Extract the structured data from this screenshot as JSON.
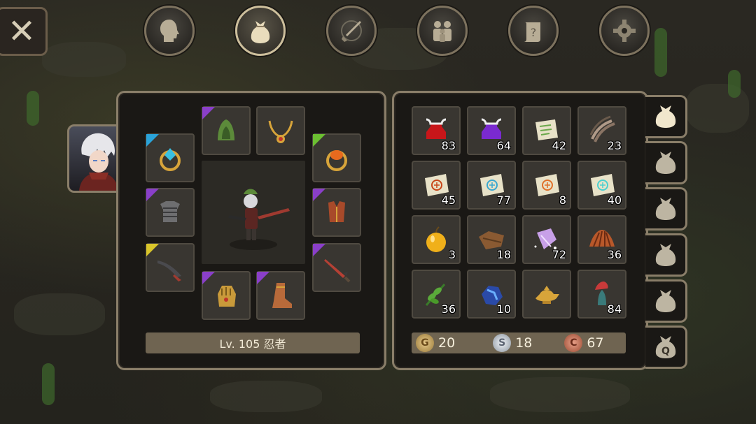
{
  "close": {
    "label": "✕"
  },
  "top_nav": [
    {
      "name": "nav-character",
      "icon": "head-icon",
      "active": false
    },
    {
      "name": "nav-inventory",
      "icon": "bag-icon",
      "active": true
    },
    {
      "name": "nav-skills",
      "icon": "sword-compass-icon",
      "active": false
    },
    {
      "name": "nav-party",
      "icon": "party-icon",
      "active": false
    },
    {
      "name": "nav-quests",
      "icon": "quest-scroll-icon",
      "active": false
    },
    {
      "name": "nav-settings",
      "icon": "gear-icon",
      "active": false
    }
  ],
  "character": {
    "level_text": "Lv. 105 忍者"
  },
  "equipment": [
    {
      "slot": "helmet",
      "icon": "green-hood-icon",
      "rarity": "#8a3fc9"
    },
    {
      "slot": "necklace",
      "icon": "gold-necklace-icon",
      "rarity": ""
    },
    {
      "slot": "ring-left",
      "icon": "blue-gem-ring-icon",
      "rarity": "#2aa3d9"
    },
    {
      "slot": "ring-right",
      "icon": "orange-gem-ring-icon",
      "rarity": "#6cbf32"
    },
    {
      "slot": "armor",
      "icon": "chainmail-icon",
      "rarity": "#8a3fc9"
    },
    {
      "slot": "cloak",
      "icon": "red-vest-icon",
      "rarity": "#8a3fc9"
    },
    {
      "slot": "weapon-left",
      "icon": "dark-blade-icon",
      "rarity": "#d9c52a"
    },
    {
      "slot": "weapon-right",
      "icon": "red-sword-icon",
      "rarity": "#8a3fc9"
    },
    {
      "slot": "gloves",
      "icon": "gold-gauntlet-icon",
      "rarity": "#8a3fc9"
    },
    {
      "slot": "boots",
      "icon": "leather-boot-icon",
      "rarity": "#8a3fc9"
    }
  ],
  "inventory": [
    {
      "icon": "red-potion-icon",
      "count": "83"
    },
    {
      "icon": "purple-potion-icon",
      "count": "64"
    },
    {
      "icon": "scroll-green-icon",
      "count": "42"
    },
    {
      "icon": "claw-icon",
      "count": "23"
    },
    {
      "icon": "scroll-red-rune-icon",
      "count": "45"
    },
    {
      "icon": "scroll-blue-rune-icon",
      "count": "77"
    },
    {
      "icon": "scroll-orange-rune-icon",
      "count": "8"
    },
    {
      "icon": "scroll-cyan-rune-icon",
      "count": "40"
    },
    {
      "icon": "golden-apple-icon",
      "count": "3"
    },
    {
      "icon": "leather-hide-icon",
      "count": "18"
    },
    {
      "icon": "crystal-shard-icon",
      "count": "72"
    },
    {
      "icon": "red-shell-icon",
      "count": "36"
    },
    {
      "icon": "green-herb-icon",
      "count": "36"
    },
    {
      "icon": "blue-ore-icon",
      "count": "10"
    },
    {
      "icon": "magic-lamp-icon",
      "count": ""
    },
    {
      "icon": "blue-mushroom-icon",
      "count": "84"
    }
  ],
  "currency": [
    {
      "name": "gold",
      "symbol": "G",
      "value": "20",
      "color": "#c9a46a"
    },
    {
      "name": "silver",
      "symbol": "S",
      "value": "18",
      "color": "#b9c2cc"
    },
    {
      "name": "copper",
      "symbol": "C",
      "value": "67",
      "color": "#c0735a"
    }
  ],
  "bag_tabs": [
    {
      "label": "",
      "active": true
    },
    {
      "label": "",
      "active": false
    },
    {
      "label": "",
      "active": false
    },
    {
      "label": "",
      "active": false
    },
    {
      "label": "",
      "active": false
    },
    {
      "label": "Q",
      "active": false
    }
  ]
}
